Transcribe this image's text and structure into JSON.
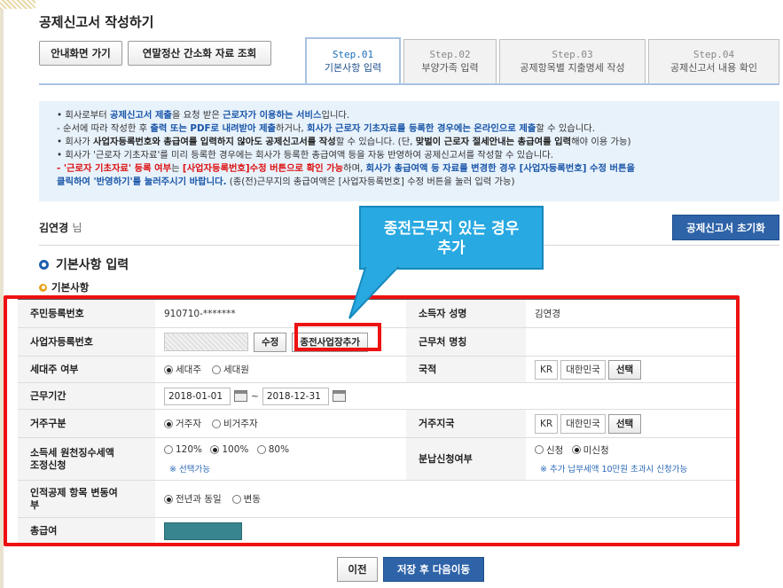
{
  "page_title": "공제신고서 작성하기",
  "top_buttons": {
    "guide": "안내화면 가기",
    "simplified": "연말정산 간소화 자료 조회"
  },
  "tabs": [
    {
      "step": "Step.01",
      "label": "기본사항 입력"
    },
    {
      "step": "Step.02",
      "label": "부양가족 입력"
    },
    {
      "step": "Step.03",
      "label": "공제항목별 지출명세 작성"
    },
    {
      "step": "Step.04",
      "label": "공제신고서 내용 확인"
    }
  ],
  "notice": {
    "l1a": "• 회사로부터 ",
    "l1b": "공제신고서 제출",
    "l1c": "을 요청 받은 ",
    "l1d": "근로자가 이용하는 서비스",
    "l1e": "입니다.",
    "l2a": "- 순서에 따라 작성한 후 ",
    "l2b": "출력 또는 PDF로 내려받아 제출",
    "l2c": "하거나, ",
    "l2d": "회사가 근로자 기초자료를 등록한 경우에는 온라인으로 제출",
    "l2e": "할 수 있습니다.",
    "l3a": "• 회사가 ",
    "l3b": "사업자등록번호와 총급여를 입력하지 않아도 공제신고서를 작성",
    "l3c": "할 수 있습니다. (단, ",
    "l3d": "맞벌이 근로자 절세안내는 총급여를 입력",
    "l3e": "해야 이용 가능)",
    "l4": "• 회사가 '근로자 기초자료'를 미리 등록한 경우에는 회사가 등록한 총급여액 등을 자동 반영하여 공제신고서를 작성할 수 있습니다.",
    "l5a": "- '근로자 기초자료' 등록 여부",
    "l5b": "는 ",
    "l5c": "[사업자등록번호]수정 버튼으로 확인 가능",
    "l5d": "하며, ",
    "l5e": "회사가 총급여액 등 자료를 변경한 경우 [사업자등록번호] 수정 버튼을",
    "l6a": "클릭하여 '반영하기'를 눌러주시기 바랍니다.",
    "l6b": " (종(전)근무지의 총급여액은 [사업자등록번호] 수정 버튼을 눌러 입력 가능)"
  },
  "user": {
    "name": "김연경",
    "suffix": "님"
  },
  "reset_button": "공제신고서 초기화",
  "section_title": "기본사항 입력",
  "subsection_title": "기본사항",
  "callout": {
    "line1": "종전근무지 있는 경우",
    "line2": "추가"
  },
  "form": {
    "resident_no": {
      "label": "주민등록번호",
      "value": "910710-*******"
    },
    "earner_name": {
      "label": "소득자 성명",
      "value": "김연경"
    },
    "biz_no": {
      "label": "사업자등록번호",
      "edit_button": "수정",
      "add_button": "종전사업장추가"
    },
    "workplace": {
      "label": "근무처 명칭",
      "value": ""
    },
    "householder": {
      "label": "세대주 여부",
      "options": [
        "세대주",
        "세대원"
      ],
      "selected": "세대주"
    },
    "nationality": {
      "label": "국적",
      "code": "KR",
      "name": "대한민국",
      "select_button": "선택"
    },
    "work_period": {
      "label": "근무기간",
      "start": "2018-01-01",
      "sep": "~",
      "end": "2018-12-31"
    },
    "residency": {
      "label": "거주구분",
      "options": [
        "거주자",
        "비거주자"
      ],
      "selected": "거주자"
    },
    "residence_country": {
      "label": "거주지국",
      "code": "KR",
      "name": "대한민국",
      "select_button": "선택"
    },
    "withholding": {
      "label_line1": "소득세 원천징수세액",
      "label_line2": "조정신청",
      "options": [
        "120%",
        "100%",
        "80%"
      ],
      "selected": "100%",
      "hint": "※ 선택가능"
    },
    "installment": {
      "label": "분납신청여부",
      "options": [
        "신청",
        "미신청"
      ],
      "selected": "미신청",
      "hint": "※ 추가 납부세액 10만원 초과시 신청가능"
    },
    "deduction_change": {
      "label_line1": "인적공제 항목 변동여",
      "label_line2": "부",
      "options": [
        "전년과 동일",
        "변동"
      ],
      "selected": "전년과 동일"
    },
    "total_pay": {
      "label": "총급여"
    }
  },
  "bottom": {
    "prev": "이전",
    "save_next": "저장 후 다음이동"
  },
  "colors": {
    "accent_blue": "#2e63a8",
    "highlight_red": "#ee1111",
    "callout_blue": "#29a9e1",
    "notice_bg": "#e8f2fb"
  }
}
